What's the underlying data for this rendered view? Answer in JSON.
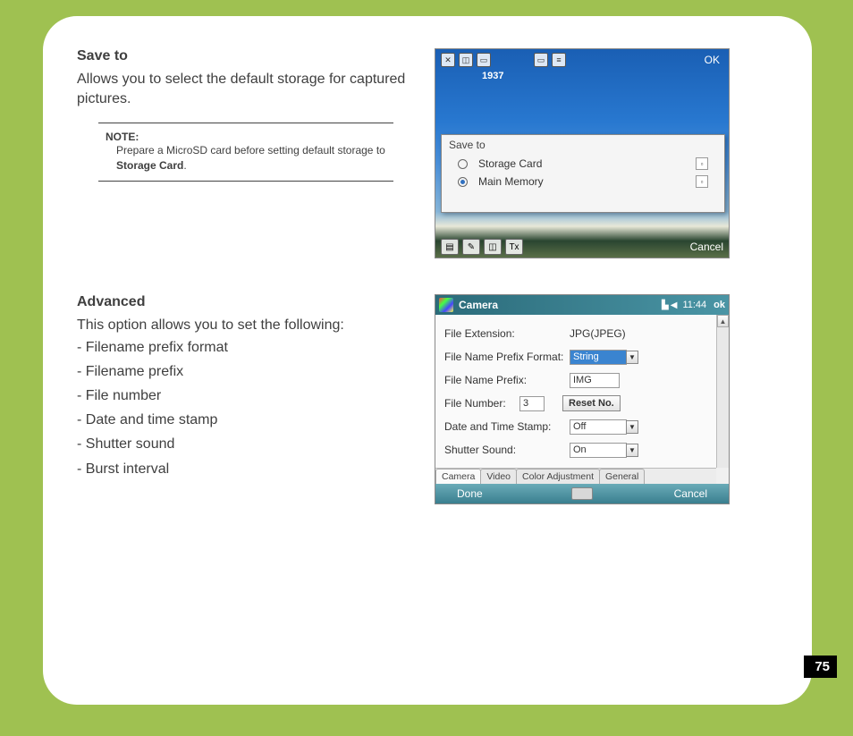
{
  "page_number": "75",
  "section1": {
    "heading": "Save to",
    "body": "Allows you to select the default storage for captured pictures.",
    "note_label": "NOTE:",
    "note_text_pre": "Prepare a MicroSD card before setting default storage to ",
    "note_bold": "Storage Card",
    "note_text_post": "."
  },
  "section2": {
    "heading": "Advanced",
    "body": "This option allows you to set the following:",
    "items": [
      "- Filename prefix format",
      "- Filename prefix",
      "- File number",
      "- Date and time stamp",
      "- Shutter sound",
      "- Burst interval"
    ]
  },
  "screenshot1": {
    "ok": "OK",
    "time": "1937",
    "popup_title": "Save to",
    "options": [
      {
        "label": "Storage Card",
        "selected": false
      },
      {
        "label": "Main Memory",
        "selected": true
      }
    ],
    "cancel": "Cancel",
    "toolbar_glyphs": [
      "✕",
      "◫",
      "▭"
    ],
    "mid_glyphs": [
      "▭",
      "≡"
    ],
    "bottom_glyphs": [
      "▤",
      "✎",
      "◫",
      "Tx"
    ]
  },
  "screenshot2": {
    "title": "Camera",
    "clock": "11:44",
    "ok": "ok",
    "rows": {
      "file_ext_label": "File Extension:",
      "file_ext_value": "JPG(JPEG)",
      "prefix_format_label": "File Name Prefix Format:",
      "prefix_format_value": "String",
      "prefix_label": "File Name Prefix:",
      "prefix_value": "IMG",
      "file_number_label": "File Number:",
      "file_number_value": "3",
      "reset_btn": "Reset No.",
      "stamp_label": "Date and Time Stamp:",
      "stamp_value": "Off",
      "shutter_label": "Shutter Sound:",
      "shutter_value": "On"
    },
    "tabs": [
      "Camera",
      "Video",
      "Color Adjustment",
      "General"
    ],
    "done": "Done",
    "cancel": "Cancel"
  }
}
